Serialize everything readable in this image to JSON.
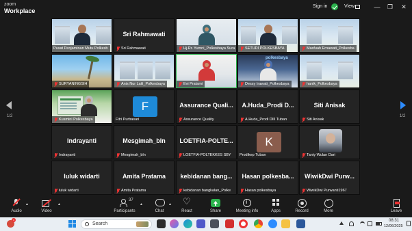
{
  "titlebar": {
    "brand_line1": "zoom",
    "brand_line2": "Workplace",
    "signin": "Sign in",
    "view": "View",
    "minimize": "—",
    "restore": "❐",
    "close": "✕"
  },
  "gallery": {
    "page_left": "1/2",
    "page_right": "1/2",
    "tiles": [
      {
        "name": "Pusat Penjaminan Mutu Polkesb"
      },
      {
        "big": "Sri Rahmawati",
        "name": "Sri Rahmawati"
      },
      {
        "name": "Hj.Rr. Yumni_Polkesbaya Sura"
      },
      {
        "name": "SETUDI POLKESBAYA"
      },
      {
        "name": "Masfuah Ernawati_Polkesba"
      },
      {
        "name": "SURYANINGSIH"
      },
      {
        "name": "Anis Nur Laili_Polkesbaya"
      },
      {
        "name": "Evi Pratami"
      },
      {
        "name": "Dessy Irawati_Polkesbaya"
      },
      {
        "name": "hanik_Polkesbaya"
      },
      {
        "name": "Kusmini Polkesbaya"
      },
      {
        "avatar": "F",
        "name": "Fitri Purbasari"
      },
      {
        "big": "Assurance  Quali...",
        "name": "Assurance Quality"
      },
      {
        "big": "A.Huda_Prodi  D...",
        "name": "A.Huda_Prodi DIII Tuban"
      },
      {
        "big": "Siti Anisak",
        "name": "Siti Anisak"
      },
      {
        "big": "Indrayanti",
        "name": "Indrayanti"
      },
      {
        "big": "Mesgimah_bln",
        "name": "Mesgimah_bln"
      },
      {
        "big": "LOETFIA-POLTE...",
        "name": "LOETFIA-POLTEKKES SBY"
      },
      {
        "avatar": "K",
        "name": "Prodikep Tuban"
      },
      {
        "name": "Tanty Wulan Dari"
      },
      {
        "big": "luluk widarti",
        "name": "luluk widarti"
      },
      {
        "big": "Amita Pratama",
        "name": "Amita Pratama"
      },
      {
        "big": "kebidanan  bang...",
        "name": "kebidanan bangkalan_Polke"
      },
      {
        "big": "Hasan  polkesba...",
        "name": "Hasan polkesbaya"
      },
      {
        "big": "WiwikDwi  Purw...",
        "name": "WiwikDwi Purwanti1967"
      }
    ],
    "poster_text": "polkesbaya"
  },
  "toolbar": {
    "audio": "Audio",
    "video": "Video",
    "participants": "Participants",
    "participants_count": "37",
    "chat": "Chat",
    "react": "React",
    "share": "Share",
    "meeting_info": "Meeting info",
    "apps": "Apps",
    "record": "Record",
    "more": "More",
    "leave": "Leave"
  },
  "taskbar": {
    "search_text": "Search",
    "notif_count": "1",
    "time": "08:31",
    "date": "12/06/2025"
  },
  "colors": {
    "share_green": "#2bb24c",
    "page_arrow_blue": "#2d8cff",
    "mic_muted_red": "#e33333"
  }
}
